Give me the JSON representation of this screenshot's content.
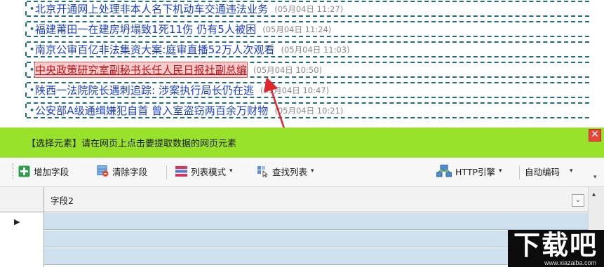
{
  "news": {
    "items": [
      {
        "title": "北京开通网上处理非本人名下机动车交通违法业务",
        "date": "(05月04日 11:27)",
        "selected": false
      },
      {
        "title": "福建莆田一在建房坍塌致1死11伤 仍有5人被困",
        "date": "(05月04日 11:24)",
        "selected": false
      },
      {
        "title": "南京公审百亿非法集资大案:庭审直播52万人次观看",
        "date": "(05月04日 11:03)",
        "selected": false
      },
      {
        "title": "中央政策研究室副秘书长任人民日报社副总编",
        "date": "(05月04日 10:50)",
        "selected": true
      },
      {
        "title": "陕西一法院院长遇刺追踪: 涉案执行局长仍在逃",
        "date": "(05月04日 10:47)",
        "selected": false
      },
      {
        "title": "公安部A级通缉嫌犯自首 曾入室盗窃两百余万财物",
        "date": "(05月04日 10:21)",
        "selected": false
      }
    ],
    "bullet": "•"
  },
  "select_bar": {
    "message": "【选择元素】请在网页上点击要提取数据的网页元素",
    "close_icon": "✕",
    "background": "#99e22b"
  },
  "toolbar": {
    "add_field": "增加字段",
    "clear_field": "清除字段",
    "list_mode": "列表模式",
    "find_list": "查找列表",
    "http_engine": "HTTP引擎",
    "auto_encoding": "自动编码",
    "caret": "▾",
    "overflow": "▾"
  },
  "grid": {
    "columns": [
      "字段2"
    ],
    "dropdown_icon": "⌄",
    "current_row_marker": "▶",
    "row_color": "#cfe0ef"
  },
  "scrollbar": {
    "up_icon": "▴"
  },
  "watermark": {
    "logo": "下载吧",
    "url": "www.xiazaiba.com"
  },
  "colors": {
    "link": "#1a3fcf",
    "selected_link": "#c2141a",
    "dash_border": "#1f6f7a",
    "date": "#8a8a8a"
  }
}
